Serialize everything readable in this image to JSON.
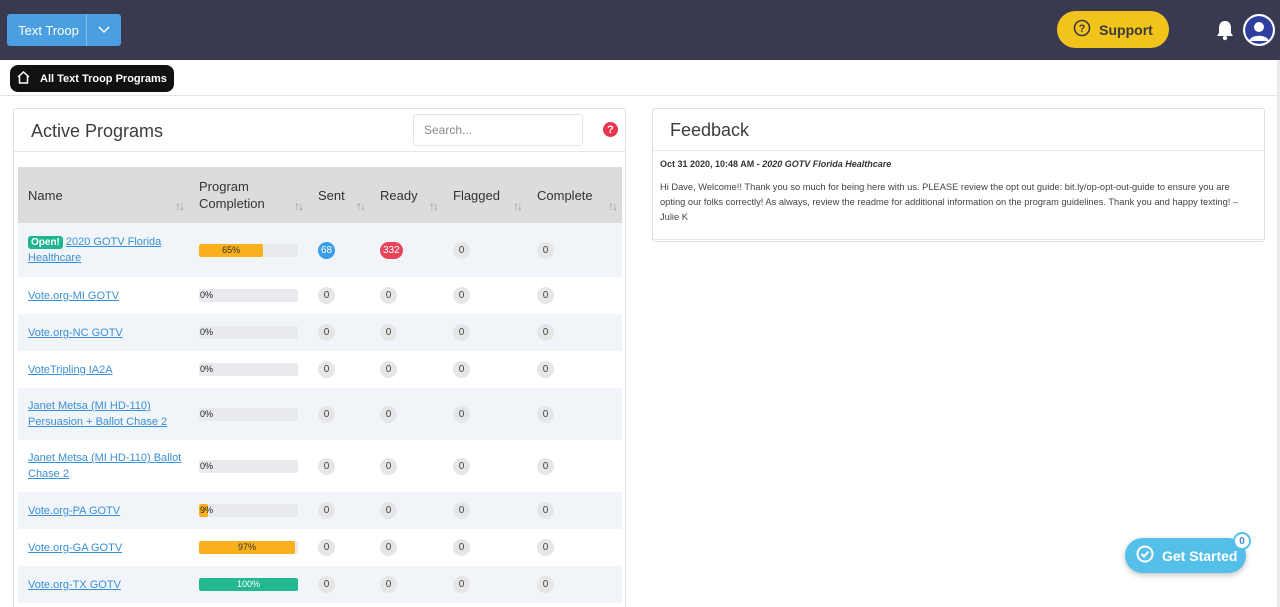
{
  "header": {
    "org_label": "Text Troop",
    "support_label": "Support",
    "icons": [
      "chevron-down-icon",
      "question-circle-icon",
      "bell-icon",
      "user-avatar-icon"
    ]
  },
  "breadcrumb": {
    "label": "All Text Troop Programs",
    "icon": "home-icon"
  },
  "programs": {
    "title": "Active Programs",
    "search_placeholder": "Search...",
    "help_label": "?",
    "columns": [
      "Name",
      "Program Completion",
      "Sent",
      "Ready",
      "Flagged",
      "Complete"
    ],
    "rows": [
      {
        "open_badge": "Open!",
        "name": "2020 GOTV Florida Healthcare",
        "completion": 65,
        "completion_label": "65%",
        "sent": "68",
        "ready": "332",
        "flagged": "0",
        "complete": "0"
      },
      {
        "open_badge": "",
        "name": "Vote.org-MI GOTV",
        "completion": 0,
        "completion_label": "0%",
        "sent": "0",
        "ready": "0",
        "flagged": "0",
        "complete": "0"
      },
      {
        "open_badge": "",
        "name": "Vote.org-NC GOTV",
        "completion": 0,
        "completion_label": "0%",
        "sent": "0",
        "ready": "0",
        "flagged": "0",
        "complete": "0"
      },
      {
        "open_badge": "",
        "name": "VoteTripling IA2A",
        "completion": 0,
        "completion_label": "0%",
        "sent": "0",
        "ready": "0",
        "flagged": "0",
        "complete": "0"
      },
      {
        "open_badge": "",
        "name": "Janet Metsa (MI HD-110) Persuasion + Ballot Chase 2",
        "completion": 0,
        "completion_label": "0%",
        "sent": "0",
        "ready": "0",
        "flagged": "0",
        "complete": "0"
      },
      {
        "open_badge": "",
        "name": "Janet Metsa (MI HD-110) Ballot Chase 2",
        "completion": 0,
        "completion_label": "0%",
        "sent": "0",
        "ready": "0",
        "flagged": "0",
        "complete": "0"
      },
      {
        "open_badge": "",
        "name": "Vote.org-PA GOTV",
        "completion": 9,
        "completion_label": "9%",
        "sent": "0",
        "ready": "0",
        "flagged": "0",
        "complete": "0"
      },
      {
        "open_badge": "",
        "name": "Vote.org-GA GOTV",
        "completion": 97,
        "completion_label": "97%",
        "sent": "0",
        "ready": "0",
        "flagged": "0",
        "complete": "0"
      },
      {
        "open_badge": "",
        "name": "Vote.org-TX GOTV",
        "completion": 100,
        "completion_label": "100%",
        "sent": "0",
        "ready": "0",
        "flagged": "0",
        "complete": "0"
      }
    ]
  },
  "feedback": {
    "title": "Feedback",
    "timestamp": "Oct 31 2020, 10:48 AM -",
    "program": "2020 GOTV Florida Healthcare",
    "message": "Hi Dave, Welcome!! Thank you so much for being here with us. PLEASE review the opt out guide: bit.ly/op-opt-out-guide to ensure you are opting our folks correctly! As always, review the readme for additional information on the program guidelines. Thank you and happy texting! – Julie K"
  },
  "get_started": {
    "label": "Get Started",
    "count": "0"
  },
  "colors": {
    "topbar": "#393a52",
    "primary": "#4a9fe0",
    "support": "#f2c31b",
    "bar_orange": "#f9b01c",
    "bar_green": "#23b88f",
    "badge_blue": "#3a9de8",
    "badge_red": "#e8455c"
  }
}
